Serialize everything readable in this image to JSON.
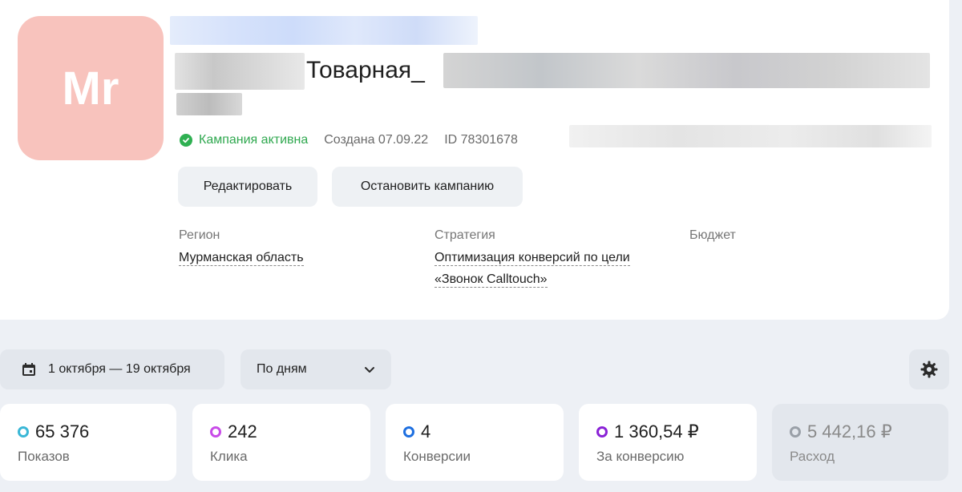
{
  "campaign": {
    "avatar_text": "Mr",
    "title_visible": "Товарная_",
    "status": "Кампания активна",
    "created": "Создана 07.09.22",
    "id": "ID 78301678",
    "actions": {
      "edit_label": "Редактировать",
      "stop_label": "Остановить кампанию"
    },
    "fields": {
      "region_label": "Регион",
      "region_value": "Мурманская область",
      "strategy_label": "Стратегия",
      "strategy_value_line1": "Оптимизация конверсий по цели",
      "strategy_value_line2": "«Звонок Calltouch»",
      "budget_label": "Бюджет"
    }
  },
  "toolbar": {
    "date_range": "1 октября — 19 октября",
    "grouping": "По дням"
  },
  "stats": [
    {
      "value": "65 376",
      "label": "Показов",
      "color": "#3ab7d6"
    },
    {
      "value": "242",
      "label": "Клика",
      "color": "#c84ce8"
    },
    {
      "value": "4",
      "label": "Конверсии",
      "color": "#1e6fe0"
    },
    {
      "value": "1 360,54 ₽",
      "label": "За конверсию",
      "color": "#8a22d6"
    },
    {
      "value": "5 442,16 ₽",
      "label": "Расход",
      "color": "#9aa0a8"
    }
  ],
  "colors": {
    "accent_green": "#2fb052",
    "avatar_bg": "#f8c3bd",
    "page_bg": "#edf0f5"
  }
}
